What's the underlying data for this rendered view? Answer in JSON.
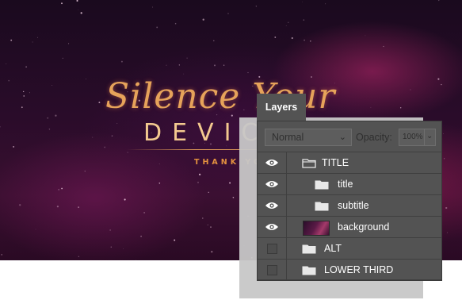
{
  "artwork": {
    "script_title": "Silence Your",
    "main_title": "DEVICES",
    "tagline": "THANK YOU"
  },
  "panel": {
    "tab_label": "Layers",
    "blend_mode": "Normal",
    "opacity_label": "Opacity:",
    "opacity_value": "100%",
    "layers": [
      {
        "name": "TITLE",
        "kind": "group",
        "visible": true,
        "indent": 0
      },
      {
        "name": "title",
        "kind": "group",
        "visible": true,
        "indent": 1
      },
      {
        "name": "subtitle",
        "kind": "group",
        "visible": true,
        "indent": 1
      },
      {
        "name": "background",
        "kind": "image",
        "visible": true,
        "indent": 1
      },
      {
        "name": "ALT",
        "kind": "group",
        "visible": false,
        "indent": 0
      },
      {
        "name": "LOWER THIRD",
        "kind": "group",
        "visible": false,
        "indent": 0
      }
    ]
  }
}
